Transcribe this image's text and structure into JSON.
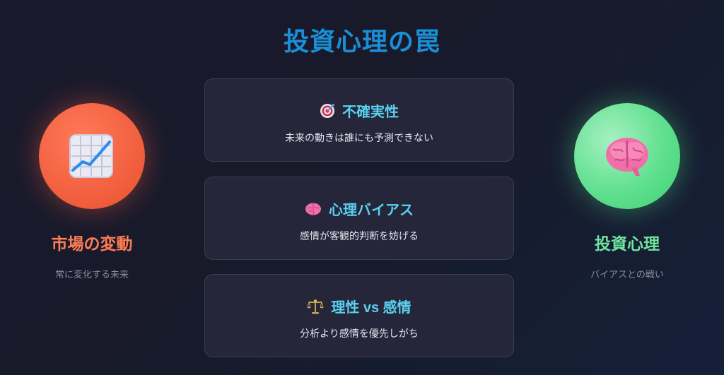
{
  "title": "投資心理の罠",
  "left": {
    "icon": "chart-increasing-icon",
    "title": "市場の変動",
    "subtitle": "常に変化する未来",
    "color": "#ff7d55"
  },
  "right": {
    "icon": "brain-icon",
    "title": "投資心理",
    "subtitle": "バイアスとの戦い",
    "color": "#6fe49c"
  },
  "cards": [
    {
      "icon": "target-icon",
      "title": "不確実性",
      "desc": "未来の動きは誰にも予測できない"
    },
    {
      "icon": "brain-icon",
      "title": "心理バイアス",
      "desc": "感情が客観的判断を妨げる"
    },
    {
      "icon": "scales-icon",
      "title": "理性 vs 感情",
      "desc": "分析より感情を優先しがち"
    }
  ]
}
